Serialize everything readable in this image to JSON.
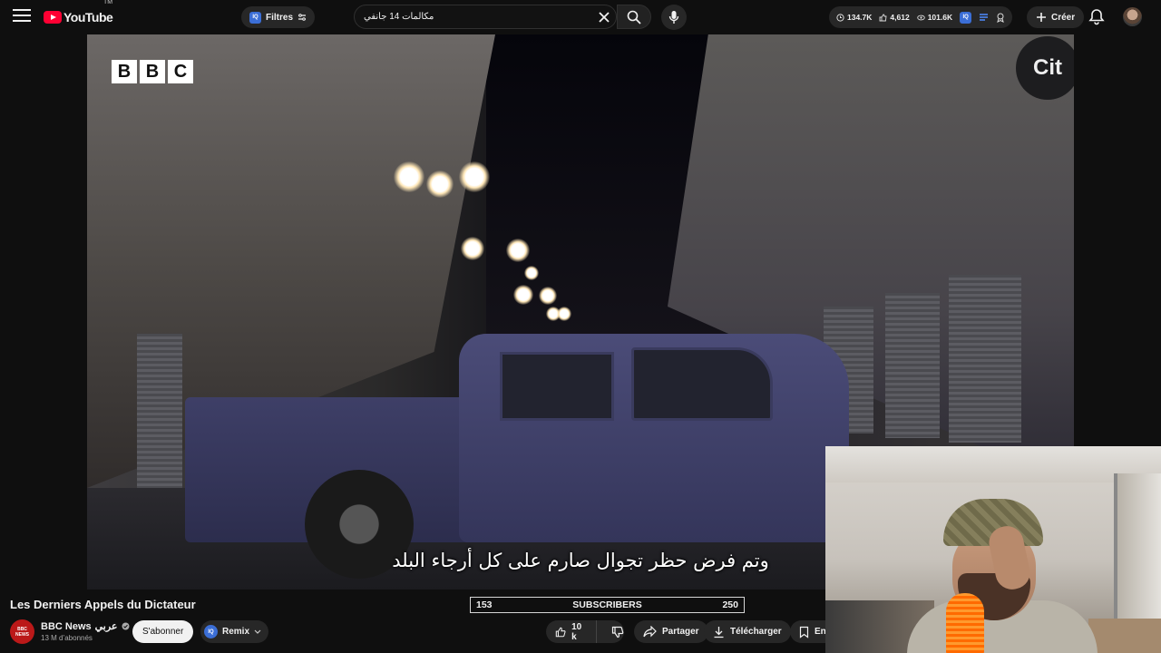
{
  "header": {
    "logo_text": "YouTube",
    "logo_tm": "TM",
    "filter_label": "Filtres",
    "filter_badge": "IQ",
    "search_value": "مكالمات 14 جانفي",
    "stats": {
      "views": "134.7K",
      "likes": "4,612",
      "other": "101.6K"
    },
    "create_label": "Créer"
  },
  "video": {
    "channel_logo": [
      "B",
      "B",
      "C"
    ],
    "store_logo": "Cit",
    "subtitle": "وتم فرض حظر تجوال صارم على كل أرجاء البلد"
  },
  "info": {
    "title": "Les Derniers Appels du Dictateur",
    "counter": {
      "left": "153",
      "label": "SUBSCRIBERS",
      "right": "250"
    },
    "channel": {
      "name": "BBC News",
      "name_suffix": "عربي",
      "subscribers": "13 M d’abonnés",
      "avatar_top": "BBC",
      "avatar_bottom": "NEWS"
    },
    "subscribe_label": "S'abonner",
    "remix_label": "Remix",
    "remix_badge": "IQ",
    "like_count": "10 k",
    "share_label": "Partager",
    "download_label": "Télécharger",
    "save_label": "En"
  },
  "colors": {
    "background": "#0f0f0f",
    "brand_red": "#ff0033",
    "chip": "#272727",
    "iq_blue": "#3b6ed6",
    "bbc_red": "#bb1919"
  },
  "icons": [
    "menu-icon",
    "youtube-logo-icon",
    "filter-sliders-icon",
    "clear-icon",
    "search-icon",
    "mic-icon",
    "eye-icon",
    "thumb-up-icon",
    "stack-icon",
    "create-plus-icon",
    "bell-icon",
    "verified-icon",
    "chevron-down-icon",
    "thumb-down-icon",
    "share-icon",
    "download-icon",
    "bookmark-icon"
  ]
}
